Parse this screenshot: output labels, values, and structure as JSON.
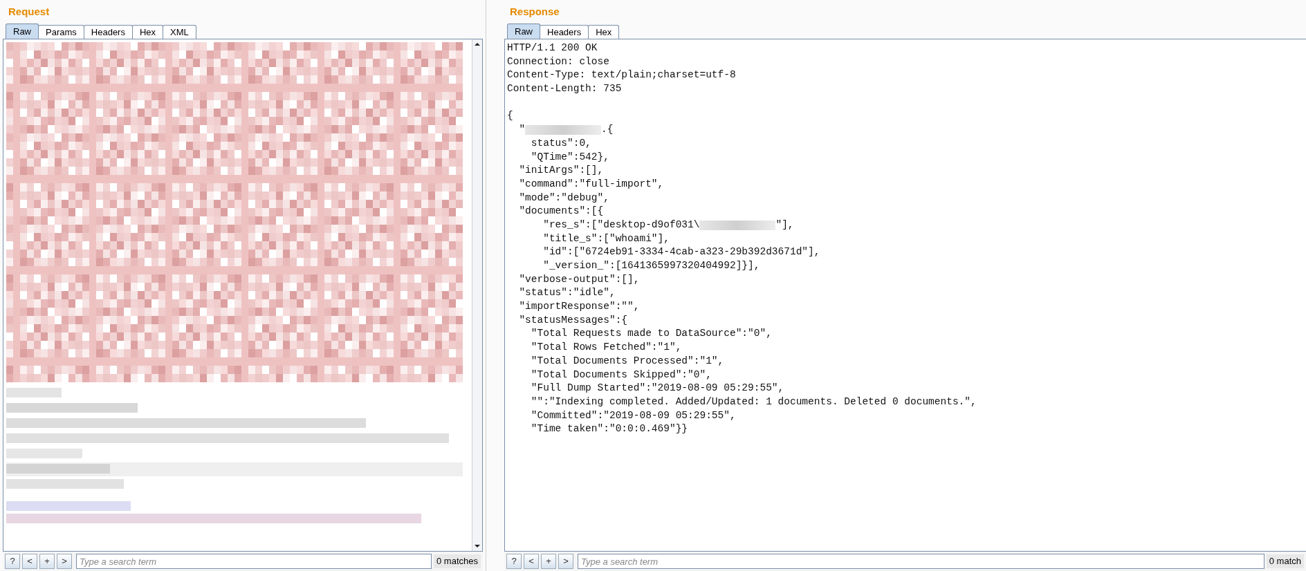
{
  "request": {
    "title": "Request",
    "tabs": [
      {
        "label": "Raw",
        "selected": true
      },
      {
        "label": "Params",
        "selected": false
      },
      {
        "label": "Headers",
        "selected": false
      },
      {
        "label": "Hex",
        "selected": false
      },
      {
        "label": "XML",
        "selected": false
      }
    ],
    "body": {
      "kind": "redacted"
    },
    "search": {
      "buttons": [
        "?",
        "<",
        "+",
        ">"
      ],
      "placeholder": "Type a search term",
      "matches": "0 matches"
    }
  },
  "response": {
    "title": "Response",
    "tabs": [
      {
        "label": "Raw",
        "selected": true
      },
      {
        "label": "Headers",
        "selected": false
      },
      {
        "label": "Hex",
        "selected": false
      }
    ],
    "lines": [
      [
        {
          "kind": "text",
          "text": "HTTP/1.1 200 OK"
        }
      ],
      [
        {
          "kind": "text",
          "text": "Connection: close"
        }
      ],
      [
        {
          "kind": "text",
          "text": "Content-Type: text/plain;charset=utf-8"
        }
      ],
      [
        {
          "kind": "text",
          "text": "Content-Length: 735"
        }
      ],
      [
        {
          "kind": "blank"
        }
      ],
      [
        {
          "kind": "text",
          "text": "{"
        }
      ],
      [
        {
          "kind": "text",
          "text": "  \""
        },
        {
          "kind": "redaction"
        },
        {
          "kind": "text",
          "text": ".{"
        }
      ],
      [
        {
          "kind": "text",
          "text": "    status\":0,"
        }
      ],
      [
        {
          "kind": "text",
          "text": "    \"QTime\":542},"
        }
      ],
      [
        {
          "kind": "text",
          "text": "  \"initArgs\":[],"
        }
      ],
      [
        {
          "kind": "text",
          "text": "  \"command\":\"full-import\","
        }
      ],
      [
        {
          "kind": "text",
          "text": "  \"mode\":\"debug\","
        }
      ],
      [
        {
          "kind": "text",
          "text": "  \"documents\":[{"
        }
      ],
      [
        {
          "kind": "text",
          "text": "      \"res_s\":[\"desktop-d9of031\\"
        },
        {
          "kind": "redaction"
        },
        {
          "kind": "text",
          "text": "\"],"
        }
      ],
      [
        {
          "kind": "text",
          "text": "      \"title_s\":[\"whoami\"],"
        }
      ],
      [
        {
          "kind": "text",
          "text": "      \"id\":[\"6724eb91-3334-4cab-a323-29b392d3671d\"],"
        }
      ],
      [
        {
          "kind": "text",
          "text": "      \"_version_\":[1641365997320404992]}],"
        }
      ],
      [
        {
          "kind": "text",
          "text": "  \"verbose-output\":[],"
        }
      ],
      [
        {
          "kind": "text",
          "text": "  \"status\":\"idle\","
        }
      ],
      [
        {
          "kind": "text",
          "text": "  \"importResponse\":\"\","
        }
      ],
      [
        {
          "kind": "text",
          "text": "  \"statusMessages\":{"
        }
      ],
      [
        {
          "kind": "text",
          "text": "    \"Total Requests made to DataSource\":\"0\","
        }
      ],
      [
        {
          "kind": "text",
          "text": "    \"Total Rows Fetched\":\"1\","
        }
      ],
      [
        {
          "kind": "text",
          "text": "    \"Total Documents Processed\":\"1\","
        }
      ],
      [
        {
          "kind": "text",
          "text": "    \"Total Documents Skipped\":\"0\","
        }
      ],
      [
        {
          "kind": "text",
          "text": "    \"Full Dump Started\":\"2019-08-09 05:29:55\","
        }
      ],
      [
        {
          "kind": "text",
          "text": "    \"\":\"Indexing completed. Added/Updated: 1 documents. Deleted 0 documents.\","
        }
      ],
      [
        {
          "kind": "text",
          "text": "    \"Committed\":\"2019-08-09 05:29:55\","
        }
      ],
      [
        {
          "kind": "text",
          "text": "    \"Time taken\":\"0:0:0.469\"}}"
        }
      ]
    ],
    "search": {
      "buttons": [
        "?",
        "<",
        "+",
        ">"
      ],
      "placeholder": "Type a search term",
      "matches": "0 match"
    }
  }
}
